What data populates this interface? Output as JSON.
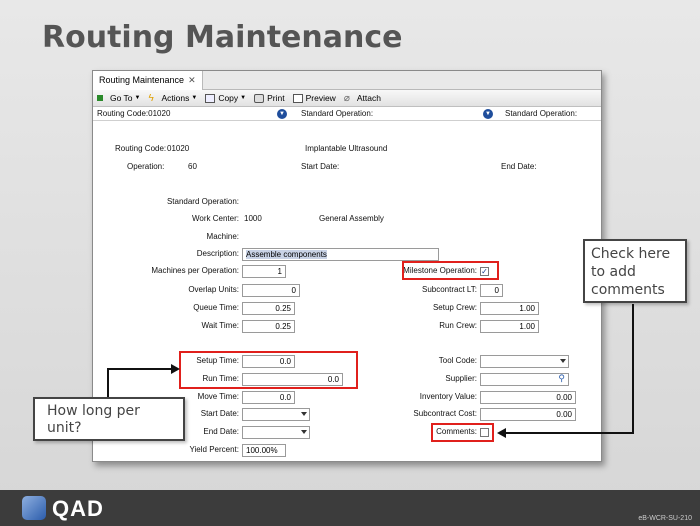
{
  "slide": {
    "title": "Routing Maintenance"
  },
  "window": {
    "tab": "Routing Maintenance",
    "toolbar": {
      "goto": "Go To",
      "actions": "Actions",
      "copy": "Copy",
      "print": "Print",
      "preview": "Preview",
      "attach": "Attach"
    },
    "codebar": {
      "routing": "Routing Code:01020",
      "std1": "Standard Operation:",
      "std2": "Standard Operation:"
    }
  },
  "header": {
    "routing_code_label": "Routing Code:",
    "routing_code": "01020",
    "routing_desc": "Implantable Ultrasound",
    "operation_label": "Operation:",
    "operation": "60",
    "start_date_label": "Start Date:",
    "end_date_label": "End Date:"
  },
  "form": {
    "std_op_label": "Standard Operation:",
    "work_center_label": "Work Center:",
    "work_center": "1000",
    "work_center_desc": "General Assembly",
    "machine_label": "Machine:",
    "description_label": "Description:",
    "description": "Assemble components",
    "machines_per_op_label": "Machines per Operation:",
    "machines_per_op": "1",
    "milestone_label": "Milestone Operation:",
    "milestone_checked": true,
    "overlap_label": "Overlap Units:",
    "overlap": "0",
    "subcontract_lt_label": "Subcontract LT:",
    "subcontract_lt": "0",
    "queue_label": "Queue Time:",
    "queue": "0.25",
    "setup_crew_label": "Setup Crew:",
    "setup_crew": "1.00",
    "wait_label": "Wait Time:",
    "wait": "0.25",
    "run_crew_label": "Run Crew:",
    "run_crew": "1.00",
    "setup_time_label": "Setup Time:",
    "setup_time": "0.0",
    "run_time_label": "Run Time:",
    "run_time": "0.0",
    "tool_code_label": "Tool Code:",
    "supplier_label": "Supplier:",
    "move_label": "Move Time:",
    "move": "0.0",
    "inventory_label": "Inventory Value:",
    "inventory": "0.00",
    "start_date2_label": "Start Date:",
    "subcontract_cost_label": "Subcontract Cost:",
    "subcontract_cost": "0.00",
    "end_date2_label": "End Date:",
    "comments_label": "Comments:",
    "comments_checked": false,
    "yield_label": "Yield Percent:",
    "yield": "100.00%"
  },
  "callouts": {
    "check": "Check here to add comments",
    "howlong": "How long per unit?"
  },
  "footer": {
    "brand": "QAD",
    "code": "eB-WCR-SU-210"
  },
  "colors": {
    "highlight": "#e0201c",
    "footer": "#3c3c3c"
  }
}
